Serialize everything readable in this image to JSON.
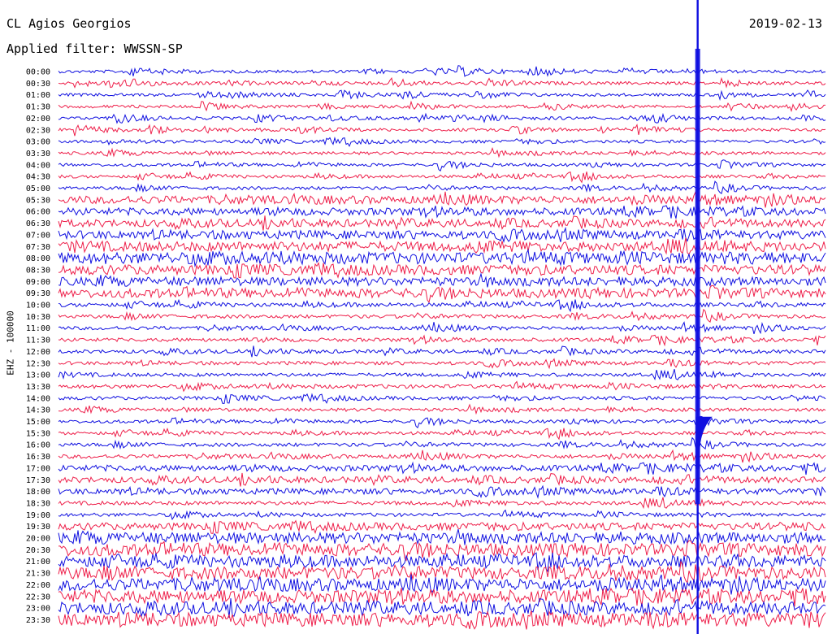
{
  "header": {
    "station": "CL Agios Georgios",
    "filter": "Applied filter: WWSSN-SP",
    "date": "2019-02-13"
  },
  "colors": {
    "odd": "#1010e0",
    "even": "#ee1f4a"
  },
  "chart_data": {
    "type": "line",
    "title": "CL Agios Georgios",
    "subtitle": "Applied filter: WWSSN-SP",
    "date": "2019-02-13",
    "ylabel": "EHZ - 100000",
    "series_interval_minutes": 30,
    "tick_labels": [
      "00:00",
      "00:30",
      "01:00",
      "01:30",
      "02:00",
      "02:30",
      "03:00",
      "03:30",
      "04:00",
      "04:30",
      "05:00",
      "05:30",
      "06:00",
      "06:30",
      "07:00",
      "07:30",
      "08:00",
      "08:30",
      "09:00",
      "09:30",
      "10:00",
      "10:30",
      "11:00",
      "11:30",
      "12:00",
      "12:30",
      "13:00",
      "13:30",
      "14:00",
      "14:30",
      "15:00",
      "15:30",
      "16:00",
      "16:30",
      "17:00",
      "17:30",
      "18:00",
      "18:30",
      "19:00",
      "19:30",
      "20:00",
      "20:30",
      "21:00",
      "21:30",
      "22:00",
      "22:30",
      "23:00",
      "23:30"
    ],
    "noise_level": [
      0.08,
      0.08,
      0.08,
      0.08,
      0.08,
      0.08,
      0.08,
      0.08,
      0.08,
      0.08,
      0.1,
      0.45,
      0.4,
      0.42,
      0.5,
      0.6,
      0.75,
      0.6,
      0.5,
      0.55,
      0.15,
      0.12,
      0.12,
      0.12,
      0.12,
      0.12,
      0.12,
      0.15,
      0.12,
      0.1,
      0.1,
      0.1,
      0.12,
      0.15,
      0.3,
      0.3,
      0.3,
      0.15,
      0.12,
      0.4,
      0.7,
      0.8,
      0.75,
      0.8,
      0.8,
      0.85,
      0.8,
      0.9
    ],
    "event": {
      "time": "15:25",
      "description": "large earthquake signal crossing all traces"
    },
    "grid": false,
    "legend": "none"
  }
}
